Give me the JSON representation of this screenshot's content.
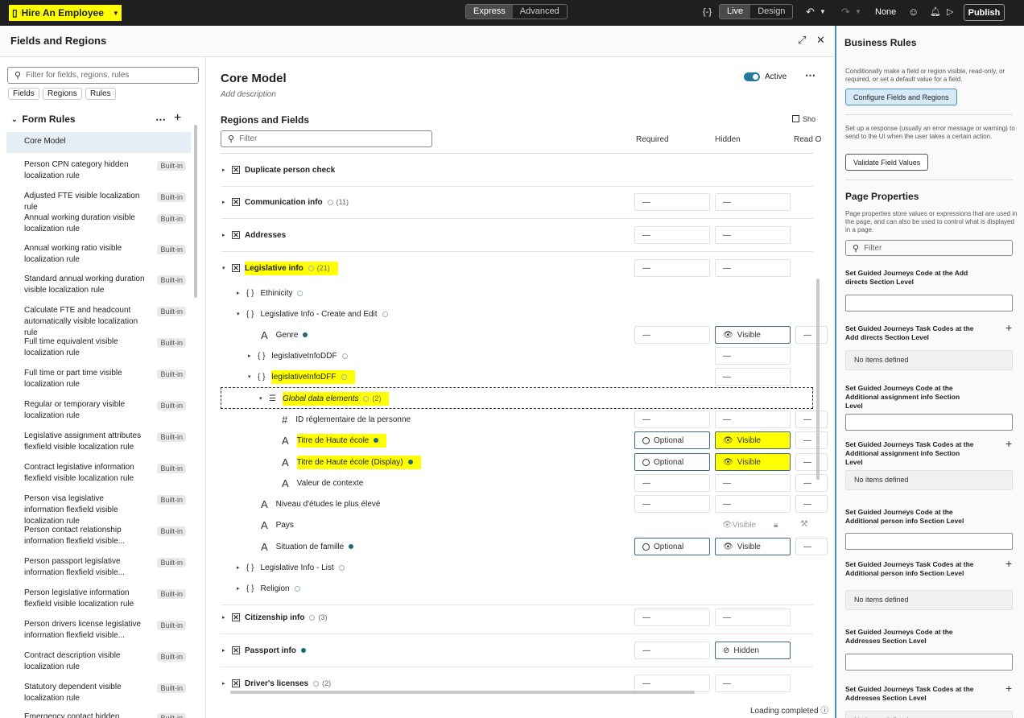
{
  "app": {
    "name": "Hire An Employee",
    "mode_express": "Express",
    "mode_advanced": "Advanced",
    "live": "Live",
    "design": "Design",
    "none": "None",
    "publish": "Publish",
    "code_icon": "{-}"
  },
  "panel": {
    "title": "Fields and Regions"
  },
  "left": {
    "search_placeholder": "Filter for fields, regions, rules",
    "chips": [
      "Fields",
      "Regions",
      "Rules"
    ],
    "form_rules": "Form Rules",
    "rules": [
      {
        "label": "Core Model",
        "badge": ""
      },
      {
        "label": "Person CPN category hidden localization rule",
        "badge": "Built-in"
      },
      {
        "label": "Adjusted FTE visible localization rule",
        "badge": "Built-in"
      },
      {
        "label": "Annual working duration visible localization rule",
        "badge": "Built-in"
      },
      {
        "label": "Annual working ratio visible localization rule",
        "badge": "Built-in"
      },
      {
        "label": "Standard annual working duration visible localization rule",
        "badge": "Built-in"
      },
      {
        "label": "Calculate FTE and headcount automatically visible localization rule",
        "badge": "Built-in"
      },
      {
        "label": "Full time equivalent visible localization rule",
        "badge": "Built-in"
      },
      {
        "label": "Full time or part time visible localization rule",
        "badge": "Built-in"
      },
      {
        "label": "Regular or temporary visible localization rule",
        "badge": "Built-in"
      },
      {
        "label": "Legislative assignment attributes flexfield visible localization rule",
        "badge": "Built-in"
      },
      {
        "label": "Contract legislative information flexfield visible localization rule",
        "badge": "Built-in"
      },
      {
        "label": "Person visa legislative information flexfield visible localization rule",
        "badge": "Built-in"
      },
      {
        "label": "Person contact relationship information flexfield visible...",
        "badge": "Built-in"
      },
      {
        "label": "Person passport legislative information flexfield visible...",
        "badge": "Built-in"
      },
      {
        "label": "Person legislative information flexfield visible localization rule",
        "badge": "Built-in"
      },
      {
        "label": "Person drivers license legislative information flexfield visible...",
        "badge": "Built-in"
      },
      {
        "label": "Contract description visible localization rule",
        "badge": "Built-in"
      },
      {
        "label": "Statutory dependent visible localization rule",
        "badge": "Built-in"
      },
      {
        "label": "Emergency contact hidden",
        "badge": "Built-in"
      }
    ]
  },
  "center": {
    "title": "Core Model",
    "description": "Add description",
    "active": "Active",
    "regions_title": "Regions and Fields",
    "filter_placeholder": "Filter",
    "show_partial": "Sho",
    "columns": {
      "required": "Required",
      "hidden": "Hidden",
      "readonly": "Read O"
    },
    "rows": [
      {
        "label": "Duplicate person check",
        "count": ""
      },
      {
        "label": "Communication info",
        "count": "(11)",
        "req": "—",
        "hid": "—"
      },
      {
        "label": "Addresses",
        "count": "",
        "req": "—",
        "hid": "—"
      },
      {
        "label": "Legislative info",
        "count": "(21)",
        "req": "—",
        "hid": "—"
      },
      {
        "label": "Ethinicity"
      },
      {
        "label": "Legislative Info - Create and Edit"
      },
      {
        "label": "Genre",
        "req": "—",
        "hid": "Visible",
        "ro": "—"
      },
      {
        "label": "legislativeInfoDDF",
        "hid": "—"
      },
      {
        "label": "legislativeInfoDFF",
        "hid": "—"
      },
      {
        "label": "Global data elements",
        "count": "(2)"
      },
      {
        "label": "ID réglementaire de la personne",
        "req": "—",
        "hid": "—",
        "ro": "—"
      },
      {
        "label": "Titre de Haute école",
        "req": "Optional",
        "hid": "Visible",
        "ro": "—"
      },
      {
        "label": "Titre de Haute école (Display)",
        "req": "Optional",
        "hid": "Visible",
        "ro": "—"
      },
      {
        "label": "Valeur de contexte",
        "req": "—",
        "hid": "—",
        "ro": "—"
      },
      {
        "label": "Niveau d'études le plus élevé",
        "req": "—",
        "hid": "—",
        "ro": "—"
      },
      {
        "label": "Pays",
        "hid": "Visible"
      },
      {
        "label": "Situation de famille",
        "req": "Optional",
        "hid": "Visible",
        "ro": "—"
      },
      {
        "label": "Legislative Info - List"
      },
      {
        "label": "Religion"
      },
      {
        "label": "Citizenship info",
        "count": "(3)",
        "req": "—",
        "hid": "—"
      },
      {
        "label": "Passport info",
        "req": "—",
        "hid": "Hidden"
      },
      {
        "label": "Driver's licenses",
        "count": "(2)",
        "req": "—",
        "hid": "—"
      }
    ],
    "loading": "Loading completed"
  },
  "right": {
    "business_rules": "Business Rules",
    "br_desc": "Conditionally make a field or region visible, read-only, or required, or set a default value for a field.",
    "configure_btn": "Configure Fields and Regions",
    "resp_desc": "Set up a response (usually an error message or warning) to send to the UI when the user takes a certain action.",
    "validate_btn": "Validate Field Values",
    "page_props": "Page Properties",
    "pp_desc": "Page properties store values or expressions that are used in the page, and can also be used to control what is displayed in a page.",
    "filter_placeholder": "Filter",
    "props": [
      "Set Guided Journeys Code at the Add directs Section Level",
      "Set Guided Journeys Task Codes at the Add directs Section Level",
      "Set Guided Journeys Code at the Additional assignment info Section Level",
      "Set Guided Journeys Task Codes at the Additional assignment info Section Level",
      "Set Guided Journeys Code at the Additional person info Section Level",
      "Set Guided Journeys Task Codes at the Additional person info Section Level",
      "Set Guided Journeys Code at the Addresses Section Level",
      "Set Guided Journeys Task Codes at the Addresses Section Level"
    ],
    "no_items": "No items defined"
  }
}
